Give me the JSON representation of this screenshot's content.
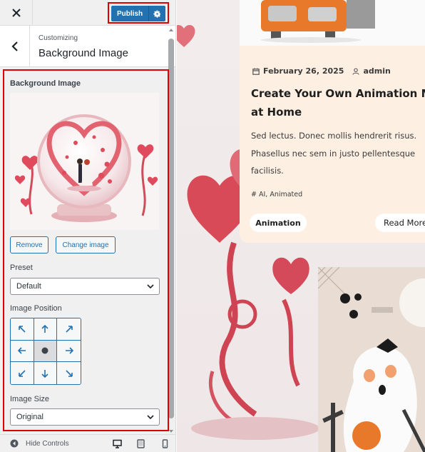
{
  "header": {
    "close_icon": "close-icon",
    "publish_label": "Publish",
    "settings_icon": "gear-icon"
  },
  "section": {
    "customizing": "Customizing",
    "title": "Background Image"
  },
  "controls": {
    "bg_image_label": "Background Image",
    "remove_label": "Remove",
    "change_label": "Change image",
    "preset_label": "Preset",
    "preset_value": "Default",
    "position_label": "Image Position",
    "position_selected": "center",
    "size_label": "Image Size",
    "size_value": "Original"
  },
  "footer": {
    "hide_controls": "Hide Controls",
    "devices": [
      "desktop",
      "tablet",
      "mobile"
    ]
  },
  "preview": {
    "post": {
      "date": "February 26, 2025",
      "author": "admin",
      "title_line1": "Create Your Own Animation Mov",
      "title_line2": "at Home",
      "excerpt": "Sed lectus. Donec mollis hendrerit risus. Phasellus nec sem in justo pellentesque facilisis.",
      "tags": "# AI, Animated",
      "category": "Animation",
      "read_more": "Read More"
    }
  },
  "colors": {
    "accent": "#2271b1",
    "highlight_border": "#e00000",
    "card_bg": "#fdf0e3"
  }
}
